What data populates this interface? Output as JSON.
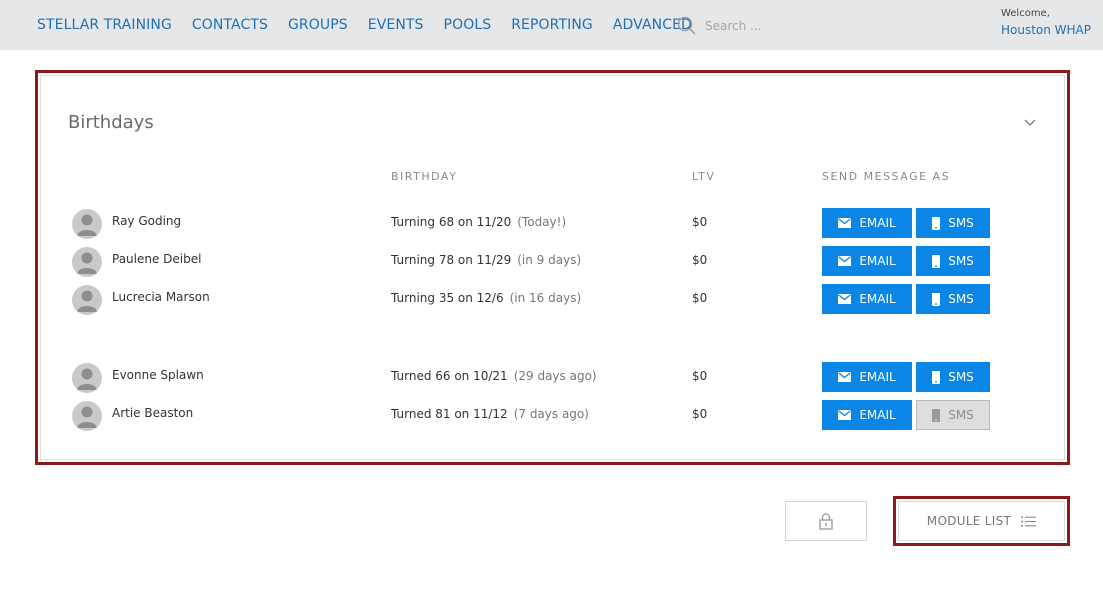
{
  "nav": {
    "items": [
      "STELLAR TRAINING",
      "CONTACTS",
      "GROUPS",
      "EVENTS",
      "POOLS",
      "REPORTING",
      "ADVANCED"
    ],
    "search_placeholder": "Search ...",
    "welcome_label": "Welcome,",
    "user_name": "Houston WHAP"
  },
  "panel": {
    "title": "Birthdays",
    "headers": {
      "birthday": "BIRTHDAY",
      "ltv": "LTV",
      "send": "SEND MESSAGE AS"
    },
    "upcoming": [
      {
        "name": "Ray Goding",
        "birthday": "Turning 68 on 11/20",
        "relative": "(Today!)",
        "ltv": "$0",
        "email": "EMAIL",
        "sms": "SMS",
        "sms_disabled": false
      },
      {
        "name": "Paulene Deibel",
        "birthday": "Turning 78 on 11/29",
        "relative": "(in 9 days)",
        "ltv": "$0",
        "email": "EMAIL",
        "sms": "SMS",
        "sms_disabled": false
      },
      {
        "name": "Lucrecia Marson",
        "birthday": "Turning 35 on 12/6",
        "relative": "(in 16 days)",
        "ltv": "$0",
        "email": "EMAIL",
        "sms": "SMS",
        "sms_disabled": false
      }
    ],
    "past": [
      {
        "name": "Evonne Splawn",
        "birthday": "Turned 66 on 10/21",
        "relative": "(29 days ago)",
        "ltv": "$0",
        "email": "EMAIL",
        "sms": "SMS",
        "sms_disabled": false
      },
      {
        "name": "Artie Beaston",
        "birthday": "Turned 81 on 11/12",
        "relative": "(7 days ago)",
        "ltv": "$0",
        "email": "EMAIL",
        "sms": "SMS",
        "sms_disabled": true
      }
    ]
  },
  "footer": {
    "module_list_label": "MODULE LIST"
  },
  "colors": {
    "nav_link": "#1f6fb5",
    "button_primary": "#0a86e6",
    "highlight": "#8b1a1a",
    "topbar": "#e6e7e8"
  },
  "icons": {
    "search": "search-icon",
    "chevron": "chevron-down-icon",
    "avatar": "avatar-icon",
    "email": "envelope-icon",
    "sms": "mobile-phone-icon",
    "lock": "lock-icon",
    "list": "list-icon"
  }
}
